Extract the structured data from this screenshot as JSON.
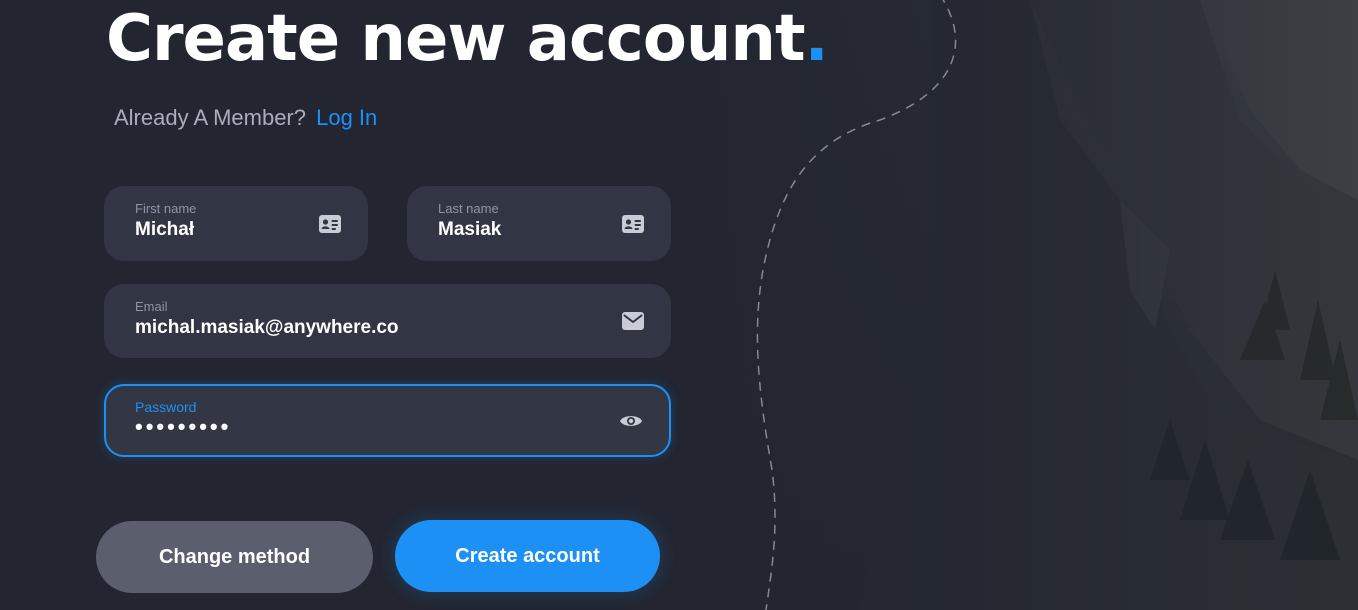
{
  "header": {
    "title": "Create new account",
    "title_dot": "."
  },
  "member": {
    "prompt": "Already A Member?",
    "login_label": "Log In"
  },
  "form": {
    "first_name": {
      "label": "First name",
      "value": "Michał",
      "icon": "id-card-icon"
    },
    "last_name": {
      "label": "Last name",
      "value": "Masiak",
      "icon": "id-card-icon"
    },
    "email": {
      "label": "Email",
      "value": "michal.masiak@anywhere.co",
      "icon": "envelope-icon"
    },
    "password": {
      "label": "Password",
      "value": "•••••••••",
      "icon": "eye-icon"
    }
  },
  "buttons": {
    "change_method": "Change method",
    "create_account": "Create account"
  },
  "colors": {
    "background": "#232631",
    "field": "#323644",
    "accent": "#1d90f5",
    "secondary_button": "#5b5f6d"
  }
}
